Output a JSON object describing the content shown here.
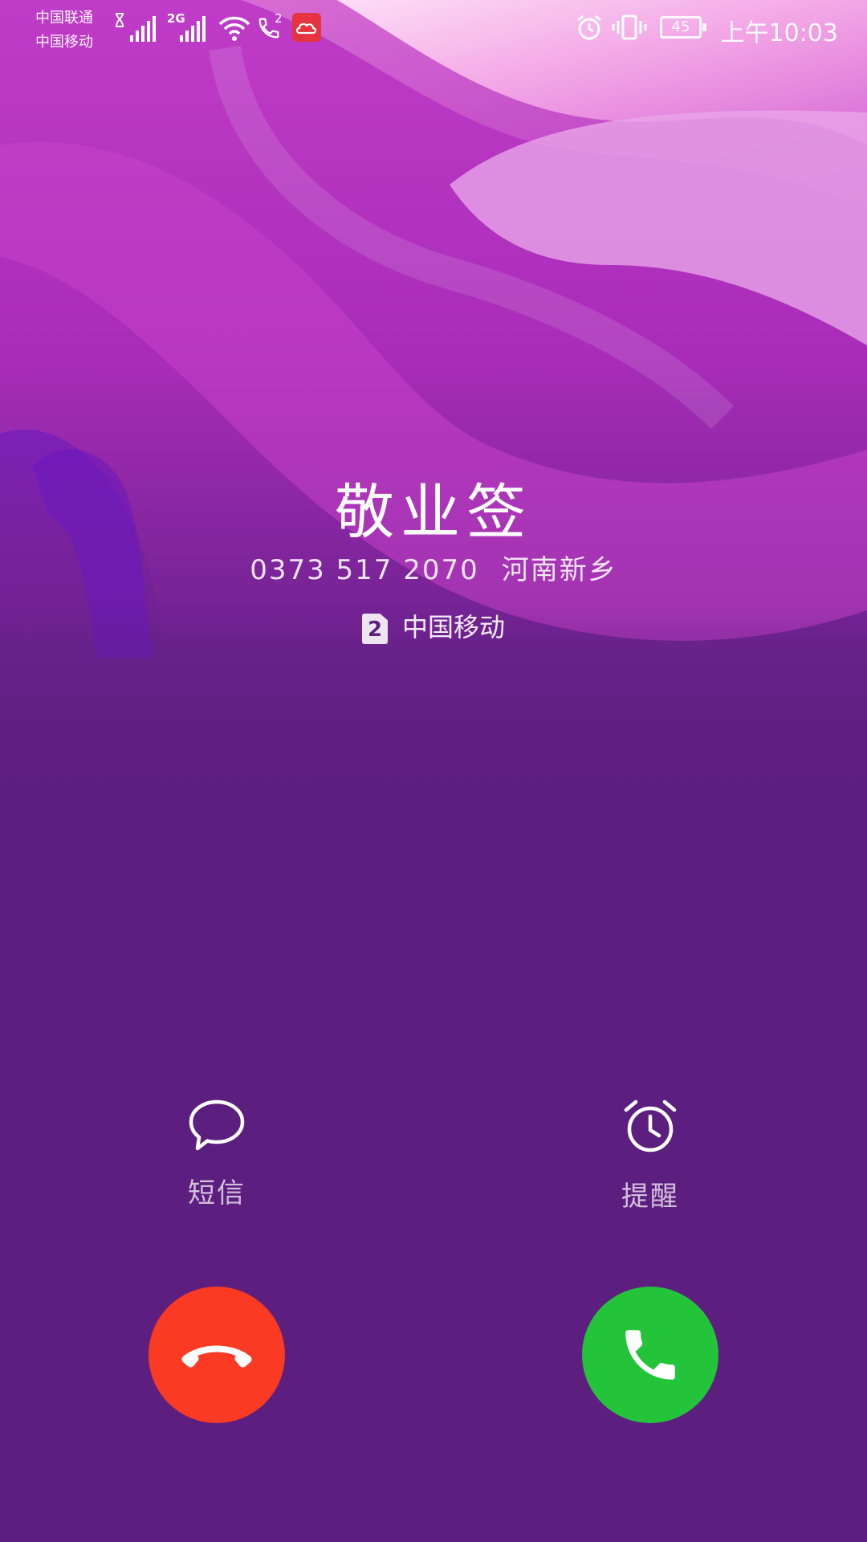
{
  "status_bar": {
    "carrier_1": "中国联通",
    "carrier_2": "中国移动",
    "network_type": "2G",
    "call_sim_slot": "2",
    "battery_level": "45",
    "time": "上午10:03"
  },
  "caller": {
    "name": "敬业签",
    "number": "0373 517 2070",
    "location": "河南新乡",
    "sim_slot": "2",
    "carrier": "中国移动"
  },
  "actions": {
    "message_label": "短信",
    "remind_label": "提醒"
  },
  "colors": {
    "background": "#5d1f7f",
    "decline": "#fa3a22",
    "answer": "#24c43a"
  },
  "icons": {
    "message": "chat-bubble-icon",
    "remind": "alarm-clock-icon",
    "decline": "hang-up-icon",
    "answer": "phone-icon"
  }
}
